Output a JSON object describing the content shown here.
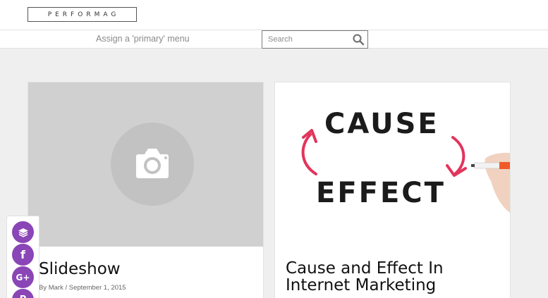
{
  "header": {
    "logo_text": "PERFORMAG"
  },
  "nav": {
    "menu_note": "Assign a 'primary' menu",
    "search_placeholder": "Search"
  },
  "posts": [
    {
      "title": "Slideshow",
      "author_prefix": "By",
      "author": "Mark",
      "separator": "/",
      "date": "September 1, 2015",
      "image": "camera-placeholder-icon"
    },
    {
      "title": "Cause and Effect In Internet Marketing",
      "image_text_top": "CAUSE",
      "image_text_bottom": "EFFECT"
    }
  ],
  "share": {
    "buttons": [
      "layers-icon",
      "facebook-icon",
      "google-plus-icon",
      "pinterest-icon"
    ],
    "facebook_glyph": "f",
    "google_glyph": "G+",
    "pinterest_glyph": "P"
  },
  "colors": {
    "share_accent": "#8a45b6",
    "page_bg": "#efefef",
    "placeholder_bg": "#d0d0d0"
  }
}
